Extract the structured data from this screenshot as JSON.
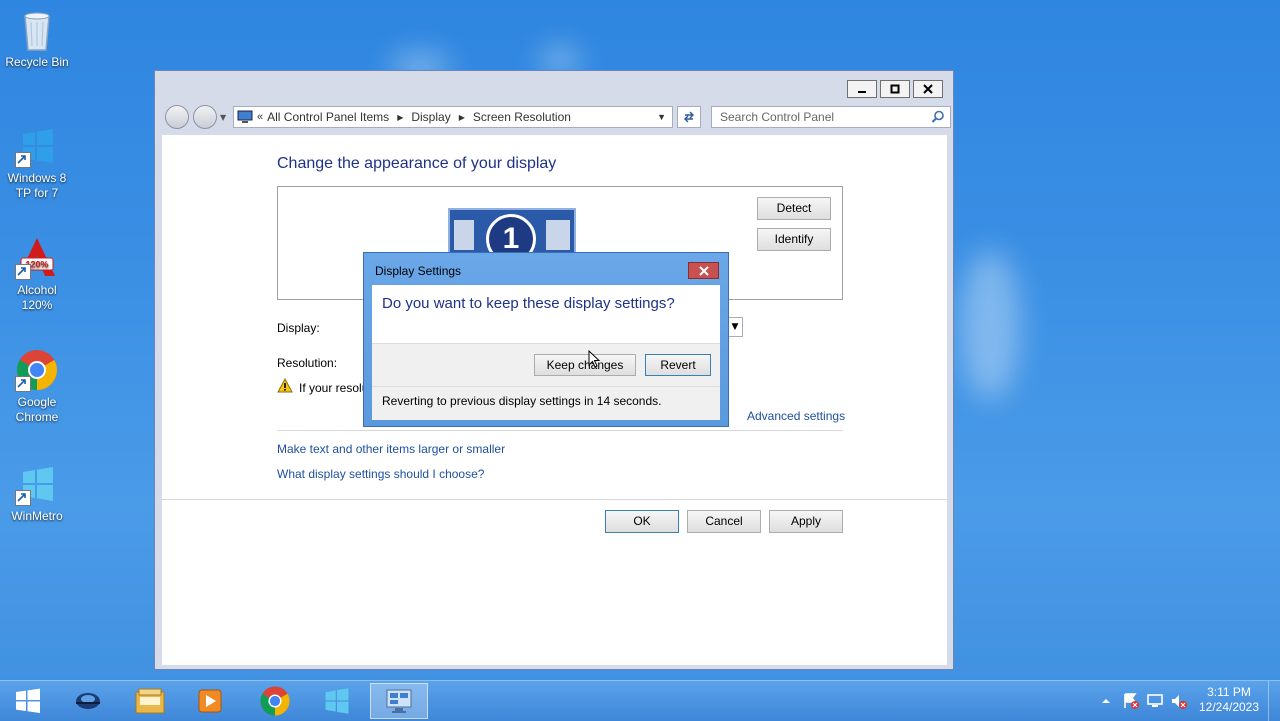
{
  "desktop": {
    "icons": [
      {
        "label": "Recycle Bin",
        "icon": "recycle-bin-icon"
      },
      {
        "label": "Windows 8 TP for 7",
        "icon": "windows-logo-icon"
      },
      {
        "label": "Alcohol 120%",
        "icon": "alcohol-icon"
      },
      {
        "label": "Google Chrome",
        "icon": "chrome-icon"
      },
      {
        "label": "WinMetro",
        "icon": "windows-logo-icon"
      }
    ]
  },
  "window": {
    "breadcrumb": [
      "All Control Panel Items",
      "Display",
      "Screen Resolution"
    ],
    "search_placeholder": "Search Control Panel",
    "heading": "Change the appearance of your display",
    "detect_label": "Detect",
    "identify_label": "Identify",
    "monitor_number": "1",
    "display_label": "Display:",
    "resolution_label": "Resolution:",
    "warning_text": "If your resolu",
    "advanced_link": "Advanced settings",
    "link_text_size": "Make text and other items larger or smaller",
    "link_which_settings": "What display settings should I choose?",
    "ok_label": "OK",
    "cancel_label": "Cancel",
    "apply_label": "Apply"
  },
  "dialog": {
    "title": "Display Settings",
    "question": "Do you want to keep these display settings?",
    "keep_label": "Keep changes",
    "revert_label": "Revert",
    "status": "Reverting to previous display settings in 14 seconds."
  },
  "taskbar": {
    "time": "3:11 PM",
    "date": "12/24/2023"
  },
  "colors": {
    "desktop": "#3a8fe4",
    "heading": "#1e3287",
    "link": "#1e4fa0",
    "close_red": "#c75050"
  }
}
